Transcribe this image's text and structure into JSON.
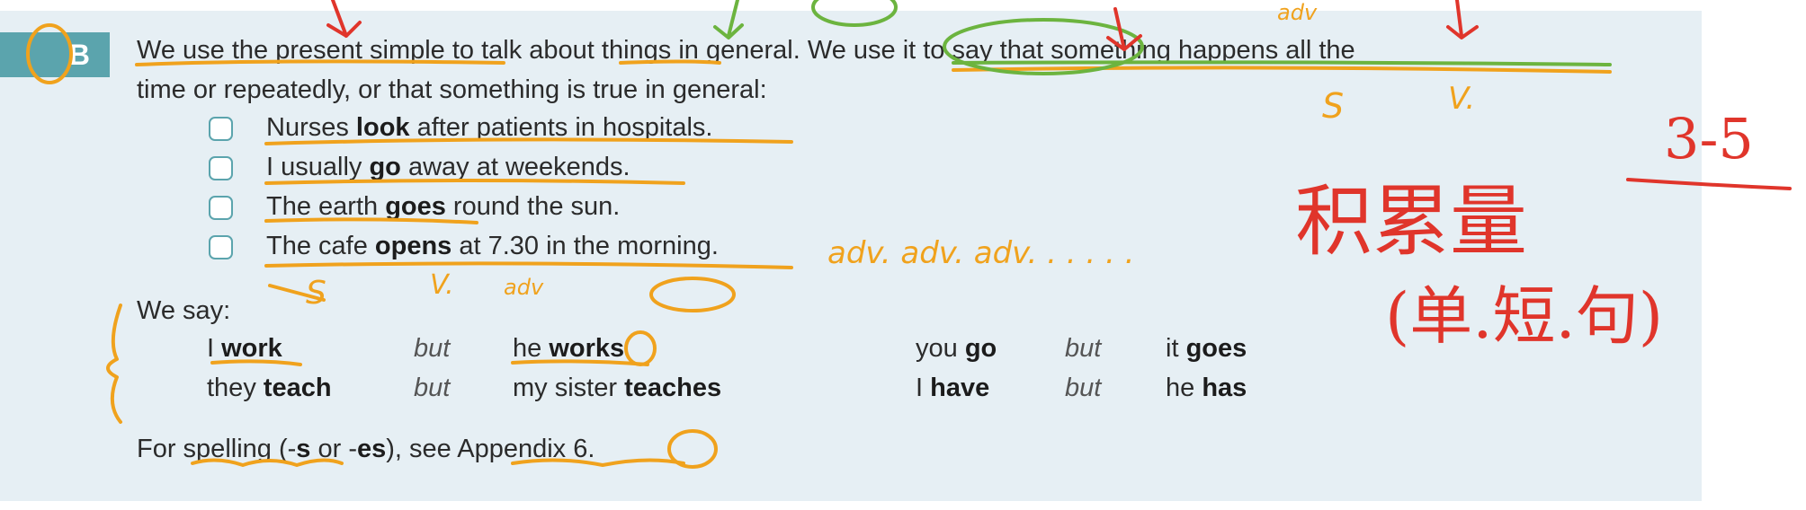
{
  "section": {
    "letter": "B"
  },
  "intro": {
    "line1": "We use the present simple to talk about things in general.  We use it to say that something happens all the",
    "line2": "time or repeatedly, or that something is true in general:"
  },
  "examples": [
    {
      "before": "Nurses ",
      "verb": "look",
      "after": " after patients in hospitals."
    },
    {
      "before": "I usually ",
      "verb": "go",
      "after": " away at weekends."
    },
    {
      "before": "The earth ",
      "verb": "goes",
      "after": " round the sun."
    },
    {
      "before": "The cafe ",
      "verb": "opens",
      "after": " at 7.30 in the morning."
    }
  ],
  "we_say": "We say:",
  "conjugations": {
    "row1": {
      "a_pron": "I ",
      "a_verb": "work",
      "but1": "but",
      "b_pron": "he ",
      "b_verb": "works",
      "c_pron": "you ",
      "c_verb": "go",
      "but2": "but",
      "d_pron": "it ",
      "d_verb": "goes"
    },
    "row2": {
      "a_pron": "they ",
      "a_verb": "teach",
      "but1": "but",
      "b_pron": "my sister ",
      "b_verb": "teaches",
      "c_pron": "I ",
      "c_verb": "have",
      "but2": "but",
      "d_pron": "he ",
      "d_verb": "has"
    }
  },
  "spelling": {
    "pre": "For spelling (-",
    "s": "s",
    "mid": " or -",
    "es": "es",
    "post": "), see Appendix 6."
  },
  "annotations": {
    "adv_chain": "adv. adv. adv. . . . . .",
    "adv_top": "adv",
    "adv_small": "adv",
    "s_mark": "S",
    "v_mark": "V.",
    "chinese": "积累量",
    "chinese_paren": "(单.短.句)",
    "range": "3-5"
  },
  "colors": {
    "panel": "#e6eff4",
    "accent": "#5ba4ad",
    "pen_orange": "#f0a21d",
    "pen_red": "#e0352b",
    "pen_green": "#6cb43f"
  }
}
